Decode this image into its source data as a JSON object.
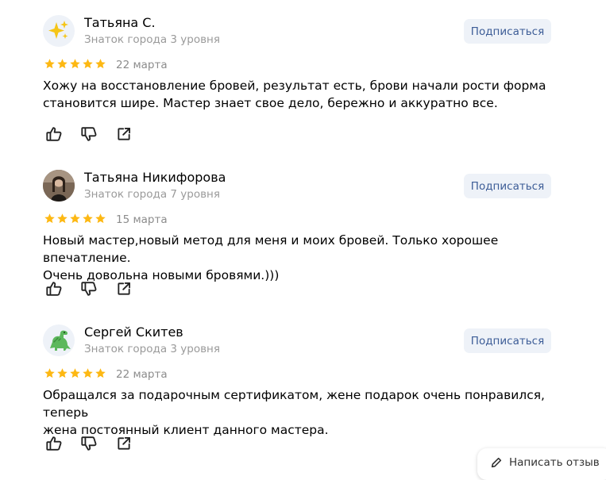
{
  "reviews": [
    {
      "author": "Татьяна С.",
      "level": "Знаток города 3 уровня",
      "avatar": "sparkles-avatar",
      "subscribe_label": "Подписаться",
      "rating": 5,
      "date": "22 марта",
      "text_lines": [
        "Хожу на восстановление бровей, результат есть, брови начали рости форма",
        "становится шире. Мастер знает свое дело, бережно и аккуратно все."
      ]
    },
    {
      "author": "Татьяна Никифорова",
      "level": "Знаток города 7 уровня",
      "avatar": "photo-avatar",
      "subscribe_label": "Подписаться",
      "rating": 5,
      "date": "15 марта",
      "text_lines": [
        "Новый мастер,новый метод для меня и моих бровей. Только хорошее впечатление.",
        "Очень довольна новыми бровями.)))"
      ]
    },
    {
      "author": "Сергей Скитев",
      "level": "Знаток города 3 уровня",
      "avatar": "dinosaur-avatar",
      "subscribe_label": "Подписаться",
      "rating": 5,
      "date": "22 марта",
      "text_lines": [
        "Обращался за подарочным сертификатом, жене подарок очень понравился, теперь",
        "жена постоянный клиент данного мастера."
      ]
    }
  ],
  "write_review_label": "Написать отзыв",
  "colors": {
    "star": "#fdb813",
    "subscribe_bg": "#eef2f8",
    "subscribe_text": "#3d5d97",
    "meta_text": "#9a9a9a"
  }
}
